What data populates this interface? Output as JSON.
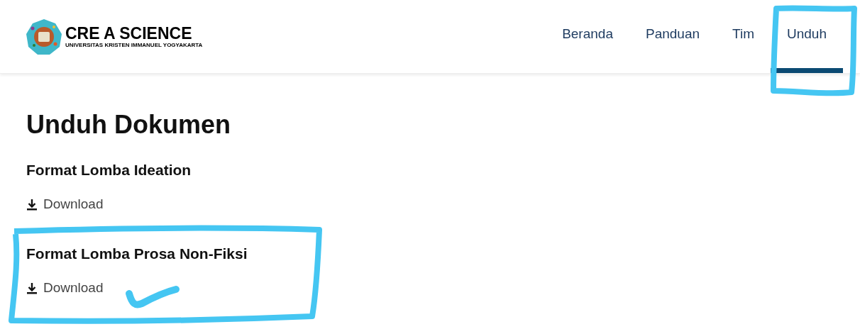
{
  "header": {
    "logo": {
      "title": "CRE A SCIENCE",
      "subtitle": "UNIVERSITAS KRISTEN IMMANUEL YOGYAKARTA"
    },
    "nav": [
      {
        "label": "Beranda",
        "selected": false
      },
      {
        "label": "Panduan",
        "selected": false
      },
      {
        "label": "Tim",
        "selected": false
      },
      {
        "label": "Unduh",
        "selected": true
      }
    ]
  },
  "page": {
    "title": "Unduh Dokumen",
    "documents": [
      {
        "title": "Format Lomba Ideation",
        "link": "Download"
      },
      {
        "title": "Format Lomba Prosa Non-Fiksi",
        "link": "Download"
      }
    ]
  }
}
